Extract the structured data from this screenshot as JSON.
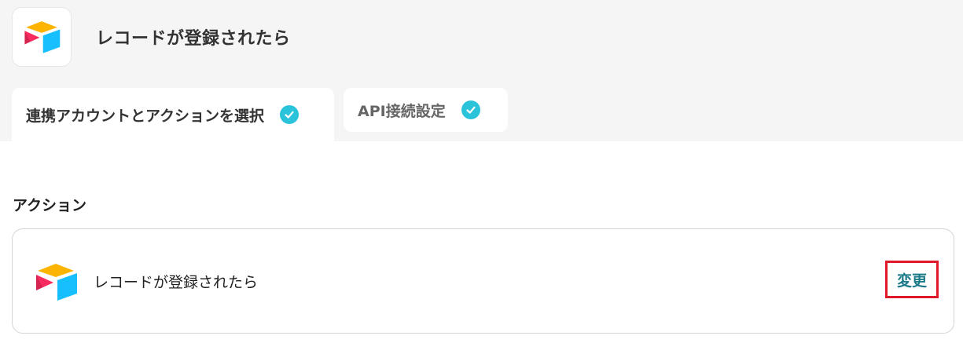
{
  "header": {
    "title": "レコードが登録されたら",
    "app_icon": "airtable-logo-icon"
  },
  "tabs": [
    {
      "label": "連携アカウントとアクションを選択",
      "completed": true,
      "active": true
    },
    {
      "label": "API接続設定",
      "completed": true,
      "active": false
    }
  ],
  "section": {
    "label": "アクション"
  },
  "action_card": {
    "title": "レコードが登録されたら",
    "icon": "airtable-logo-icon",
    "change_label": "変更"
  },
  "colors": {
    "check": "#2bc3d9",
    "highlight_border": "#e0192a",
    "link": "#1b7a8a",
    "top_background": "#f5f5f5"
  }
}
